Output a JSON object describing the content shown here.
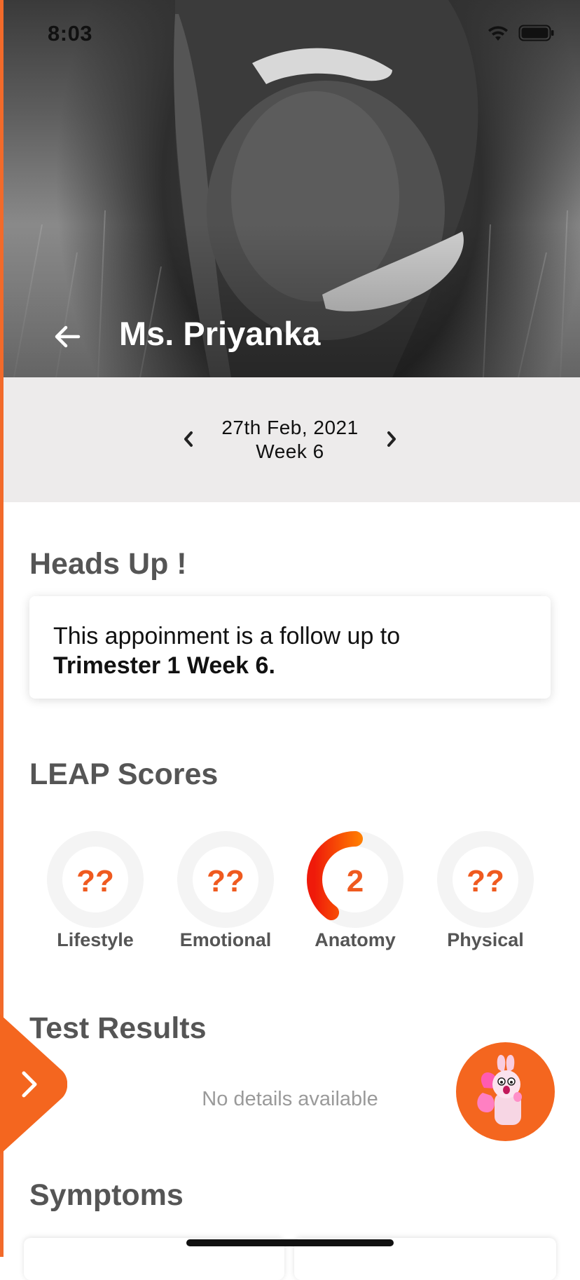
{
  "status_bar": {
    "time": "8:03",
    "icons": [
      "wifi-icon",
      "battery-icon"
    ]
  },
  "header": {
    "title": "Ms. Priyanka",
    "back_icon": "arrow-left-icon"
  },
  "date_nav": {
    "date": "27th Feb, 2021",
    "week": "Week 6",
    "prev_icon": "chevron-left-icon",
    "next_icon": "chevron-right-icon"
  },
  "heads_up": {
    "title": "Heads Up !",
    "message": "This appoinment is a follow up to",
    "message_bold": "Trimester 1 Week 6."
  },
  "leap": {
    "title": "LEAP Scores",
    "scores": [
      {
        "label": "Lifestyle",
        "value": "??",
        "progress": 0
      },
      {
        "label": "Emotional",
        "value": "??",
        "progress": 0
      },
      {
        "label": "Anatomy",
        "value": "2",
        "progress": 0.4
      },
      {
        "label": "Physical",
        "value": "??",
        "progress": 0
      }
    ]
  },
  "test_results": {
    "title": "Test Results",
    "empty": "No details available"
  },
  "symptoms": {
    "title": "Symptoms"
  },
  "colors": {
    "accent": "#f4661f",
    "ring_track": "#f4f4f4",
    "ring_start": "#ffc400",
    "ring_end": "#ef1a0a",
    "date_bar": "#edebeb"
  }
}
